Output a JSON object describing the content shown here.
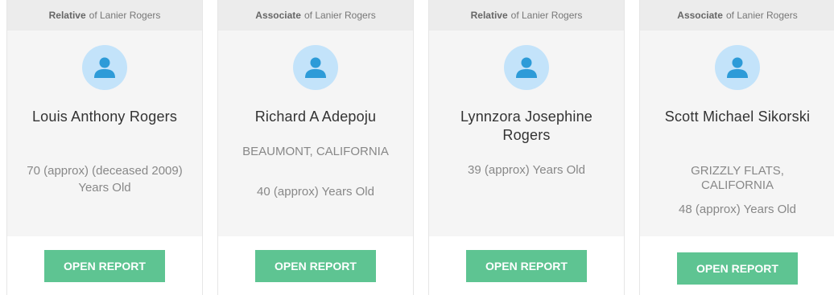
{
  "of_text": "of Lanier Rogers",
  "button_label": "OPEN REPORT",
  "colors": {
    "button": "#5ec492",
    "avatar_bg": "#c3e3fa",
    "avatar_icon": "#2d9bd8"
  },
  "cards": [
    {
      "relation": "Relative",
      "name": "Louis Anthony Rogers",
      "location": "",
      "age": "70 (approx) (deceased 2009) Years Old"
    },
    {
      "relation": "Associate",
      "name": "Richard A Adepoju",
      "location": "BEAUMONT, CALIFORNIA",
      "age": "40 (approx) Years Old"
    },
    {
      "relation": "Relative",
      "name": "Lynnzora Josephine Rogers",
      "location": "",
      "age": "39 (approx) Years Old"
    },
    {
      "relation": "Associate",
      "name": "Scott Michael Sikorski",
      "location": "GRIZZLY FLATS, CALIFORNIA",
      "age": "48 (approx) Years Old"
    }
  ]
}
